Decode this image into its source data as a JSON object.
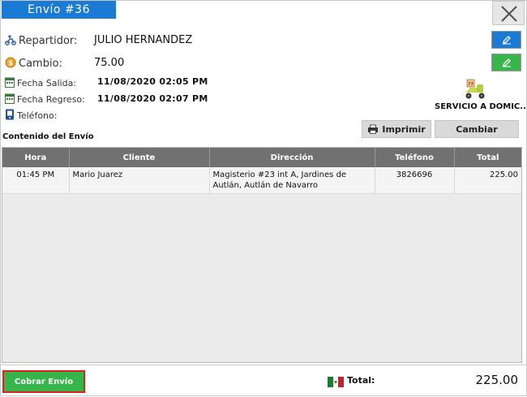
{
  "window": {
    "title": "Envío #36"
  },
  "info": {
    "repartidor_label": "Repartidor:",
    "repartidor_value": "JULIO HERNANDEZ",
    "cambio_label": "Cambio:",
    "cambio_value": "75.00",
    "fecha_salida_label": "Fecha Salida:",
    "fecha_salida_value": "11/08/2020 02:05 PM",
    "fecha_regreso_label": "Fecha Regreso:",
    "fecha_regreso_value": "11/08/2020 02:07 PM",
    "telefono_label": "Teléfono:",
    "telefono_value": ""
  },
  "service": {
    "label": "SERVICIO A DOMIC..."
  },
  "actions": {
    "print_label": "Imprimir",
    "change_label": "Cambiar",
    "collect_label": "Cobrar Envío"
  },
  "section": {
    "contents_label": "Contenido del Envío"
  },
  "table": {
    "columns": [
      "Hora",
      "Cliente",
      "Dirección",
      "Teléfono",
      "Total"
    ],
    "rows": [
      {
        "hora": "01:45 PM",
        "cliente": "Mario Juarez",
        "direccion": "Magisterio #23 int A, Jardines de Autlán, Autlán de Navarro",
        "telefono": "3826696",
        "total": "225.00"
      }
    ]
  },
  "footer": {
    "total_label": "Total:",
    "total_value": "225.00"
  },
  "colors": {
    "title_blue": "#1a7ad4",
    "edit_blue": "#1a7ad4",
    "edit_green": "#35b54a",
    "header_gray": "#717171",
    "collect_green": "#35b54a",
    "collect_border": "#e02020"
  }
}
